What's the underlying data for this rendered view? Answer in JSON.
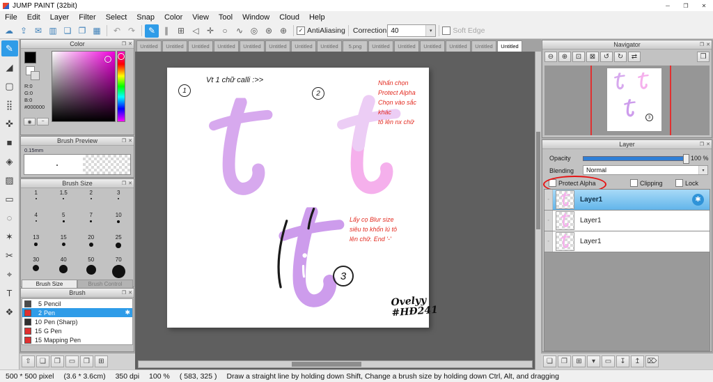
{
  "colors": {
    "accent": "#2f9ce8",
    "selection": "#8fd0f4",
    "annotation_red": "#e32b20",
    "letter_lavender": "#d7a9ee",
    "letter_pink": "#f5b0ec",
    "letter_purple": "#cd9cec",
    "slider_blue": "#2f7fd6"
  },
  "ui": {
    "check": "✓",
    "dropdown_arrow": "▾",
    "panel_detach": "❐",
    "panel_close": "✕"
  },
  "titlebar": {
    "title": "JUMP PAINT (32bit)",
    "controls": [
      {
        "name": "minimize-button",
        "glyph": "─"
      },
      {
        "name": "maximize-button",
        "glyph": "❐"
      },
      {
        "name": "close-button",
        "glyph": "✕"
      }
    ]
  },
  "menubar": {
    "items": [
      {
        "label": "File"
      },
      {
        "label": "Edit"
      },
      {
        "label": "Layer"
      },
      {
        "label": "Filter"
      },
      {
        "label": "Select"
      },
      {
        "label": "Snap"
      },
      {
        "label": "Color"
      },
      {
        "label": "View"
      },
      {
        "label": "Tool"
      },
      {
        "label": "Window"
      },
      {
        "label": "Cloud"
      },
      {
        "label": "Help"
      }
    ]
  },
  "toolbar": {
    "file_icons": [
      {
        "name": "cloud-icon",
        "glyph": "☁"
      },
      {
        "name": "upload-icon",
        "glyph": "⇪"
      },
      {
        "name": "comment-icon",
        "glyph": "✉"
      },
      {
        "name": "panel-layout-icon",
        "glyph": "▥"
      },
      {
        "name": "new-canvas-icon",
        "glyph": "❏"
      },
      {
        "name": "canvases-icon",
        "glyph": "❐"
      },
      {
        "name": "material-grid-icon",
        "glyph": "▦"
      }
    ],
    "history_icons": [
      {
        "name": "undo-icon",
        "glyph": "↶"
      },
      {
        "name": "redo-icon",
        "glyph": "↷"
      }
    ],
    "snap_icons": [
      {
        "name": "pen-mode-icon",
        "glyph": "✎",
        "selected": true
      },
      {
        "name": "parallel-snap-icon",
        "glyph": "∥"
      },
      {
        "name": "grid-snap-icon",
        "glyph": "⊞"
      },
      {
        "name": "triangle-snap-icon",
        "glyph": "◁"
      },
      {
        "name": "cross-snap-icon",
        "glyph": "✛"
      },
      {
        "name": "circle-snap-icon",
        "glyph": "○"
      },
      {
        "name": "curve-snap-icon",
        "glyph": "∿"
      },
      {
        "name": "radial-snap-icon",
        "glyph": "◎"
      },
      {
        "name": "vanishing-point-snap-icon",
        "glyph": "⊛"
      },
      {
        "name": "snap-settings-icon",
        "glyph": "⊕"
      }
    ],
    "antialiasing": {
      "label": "AntiAliasing",
      "checked": true
    },
    "correction": {
      "label": "Correction",
      "value": "40"
    },
    "soft_edge": {
      "label": "Soft Edge",
      "checked": false
    }
  },
  "toolstrip": {
    "tools": [
      {
        "name": "brush-tool",
        "glyph": "✎",
        "selected": true
      },
      {
        "name": "eraser-tool",
        "glyph": "◢"
      },
      {
        "name": "shape-brush-tool",
        "glyph": "▢"
      },
      {
        "name": "dot-pen-tool",
        "glyph": "⣿"
      },
      {
        "name": "move-tool",
        "glyph": "✜"
      },
      {
        "name": "rect-fill-tool",
        "glyph": "■"
      },
      {
        "name": "bucket-tool",
        "glyph": "◈"
      },
      {
        "name": "gradient-tool",
        "glyph": "▨"
      },
      {
        "name": "select-tool",
        "glyph": "▭"
      },
      {
        "name": "lasso-tool",
        "glyph": "◌"
      },
      {
        "name": "magic-wand-tool",
        "glyph": "✶"
      },
      {
        "name": "scissors-tool",
        "glyph": "✂"
      },
      {
        "name": "eyedropper-tool",
        "glyph": "⌖"
      },
      {
        "name": "text-tool",
        "glyph": "T"
      },
      {
        "name": "pan-tool",
        "glyph": "❖"
      }
    ]
  },
  "panels": {
    "color": {
      "title": "Color",
      "r": "R:0",
      "g": "G:0",
      "b": "B:0",
      "hex": "#000000"
    },
    "brush_preview": {
      "title": "Brush Preview",
      "size_label": "0.15mm"
    },
    "brush_size": {
      "title": "Brush Size",
      "sizes": [
        "1",
        "1.5",
        "2",
        "3",
        "4",
        "5",
        "7",
        "10",
        "13",
        "15",
        "20",
        "25",
        "30",
        "40",
        "50",
        "70"
      ],
      "tabs": [
        {
          "label": "Brush Size",
          "selected": true
        },
        {
          "label": "Brush Control",
          "selected": false
        }
      ]
    },
    "brush": {
      "title": "Brush",
      "brushes": [
        {
          "size": "5",
          "name": "Pencil",
          "swatch": "#4a4a4a"
        },
        {
          "size": "2",
          "name": "Pen",
          "swatch": "#e03030",
          "selected": true
        },
        {
          "size": "10",
          "name": "Pen (Sharp)",
          "swatch": "#303030"
        },
        {
          "size": "15",
          "name": "G Pen",
          "swatch": "#e03030"
        },
        {
          "size": "15",
          "name": "Mapping Pen",
          "swatch": "#e03030"
        }
      ],
      "footer_icons": [
        {
          "name": "dock-toggle-icon",
          "glyph": "⇧"
        },
        {
          "name": "new-brush-icon",
          "glyph": "❏"
        },
        {
          "name": "duplicate-brush-icon",
          "glyph": "❐"
        },
        {
          "name": "open-folder-icon",
          "glyph": "▭"
        },
        {
          "name": "save-brush-icon",
          "glyph": "❒"
        },
        {
          "name": "brush-grid-view-icon",
          "glyph": "⊞"
        }
      ]
    },
    "navigator": {
      "title": "Navigator",
      "icons": [
        {
          "name": "zoom-out-icon",
          "glyph": "⊖"
        },
        {
          "name": "zoom-in-icon",
          "glyph": "⊕"
        },
        {
          "name": "fit-window-icon",
          "glyph": "⊡"
        },
        {
          "name": "actual-size-icon",
          "glyph": "⊠"
        },
        {
          "name": "rotate-left-icon",
          "glyph": "↺"
        },
        {
          "name": "rotate-right-icon",
          "glyph": "↻"
        },
        {
          "name": "flip-horizontal-icon",
          "glyph": "⇄"
        },
        {
          "name": "print-icon",
          "glyph": "❒"
        }
      ]
    },
    "layer": {
      "title": "Layer",
      "opacity_label": "Opacity",
      "opacity_value": "100 %",
      "blending_label": "Blending",
      "blending_value": "Normal",
      "checkboxes": [
        {
          "label": "Protect Alpha",
          "checked": false,
          "highlighted": true
        },
        {
          "label": "Clipping",
          "checked": false
        },
        {
          "label": "Lock",
          "checked": false
        }
      ],
      "layers": [
        {
          "name": "Layer1",
          "selected": true
        },
        {
          "name": "Layer1"
        },
        {
          "name": "Layer1"
        }
      ],
      "footer_icons": [
        {
          "name": "add-layer-icon",
          "glyph": "❏"
        },
        {
          "name": "add-folder-icon",
          "glyph": "❐"
        },
        {
          "name": "duplicate-layer-icon",
          "glyph": "⊞"
        },
        {
          "name": "layer-menu-icon",
          "glyph": "▾"
        },
        {
          "name": "folder-icon",
          "glyph": "▭"
        },
        {
          "name": "merge-down-icon",
          "glyph": "↧"
        },
        {
          "name": "transfer-icon",
          "glyph": "↥"
        },
        {
          "name": "delete-layer-icon",
          "glyph": "⌦"
        }
      ]
    }
  },
  "document_tabs": [
    {
      "label": "Untitled"
    },
    {
      "label": "Untitled"
    },
    {
      "label": "Untitled"
    },
    {
      "label": "Untitled"
    },
    {
      "label": "Untitled"
    },
    {
      "label": "Untitled"
    },
    {
      "label": "Untitled"
    },
    {
      "label": "Untitled"
    },
    {
      "label": "5.png"
    },
    {
      "label": "Untitled"
    },
    {
      "label": "Untitled"
    },
    {
      "label": "Untitled"
    },
    {
      "label": "Untitled"
    },
    {
      "label": "Untitled"
    },
    {
      "label": "Untitled",
      "active": true
    }
  ],
  "canvas": {
    "badge1": "1",
    "badge2": "2",
    "badge3": "3",
    "step1_label": "Vt 1 chữ calli :>>",
    "note1_lines": [
      "Nhấn chọn",
      "Protect Alpha",
      "Chọn vào sắc khác",
      "tô lên nx chữ"
    ],
    "note2_lines": [
      "Lấy cọ Blur size",
      "siêu to khổn lú tô",
      "lên chữ. End '-'"
    ],
    "signature": [
      "Ovelyy",
      "#HĐ241"
    ]
  },
  "statusbar": {
    "segments": [
      "500 * 500 pixel",
      "(3.6 * 3.6cm)",
      "350 dpi",
      "100 %",
      "( 583, 325 )"
    ],
    "hint": "Draw a straight line by holding down Shift, Change a brush size by holding down Ctrl, Alt, and dragging"
  }
}
